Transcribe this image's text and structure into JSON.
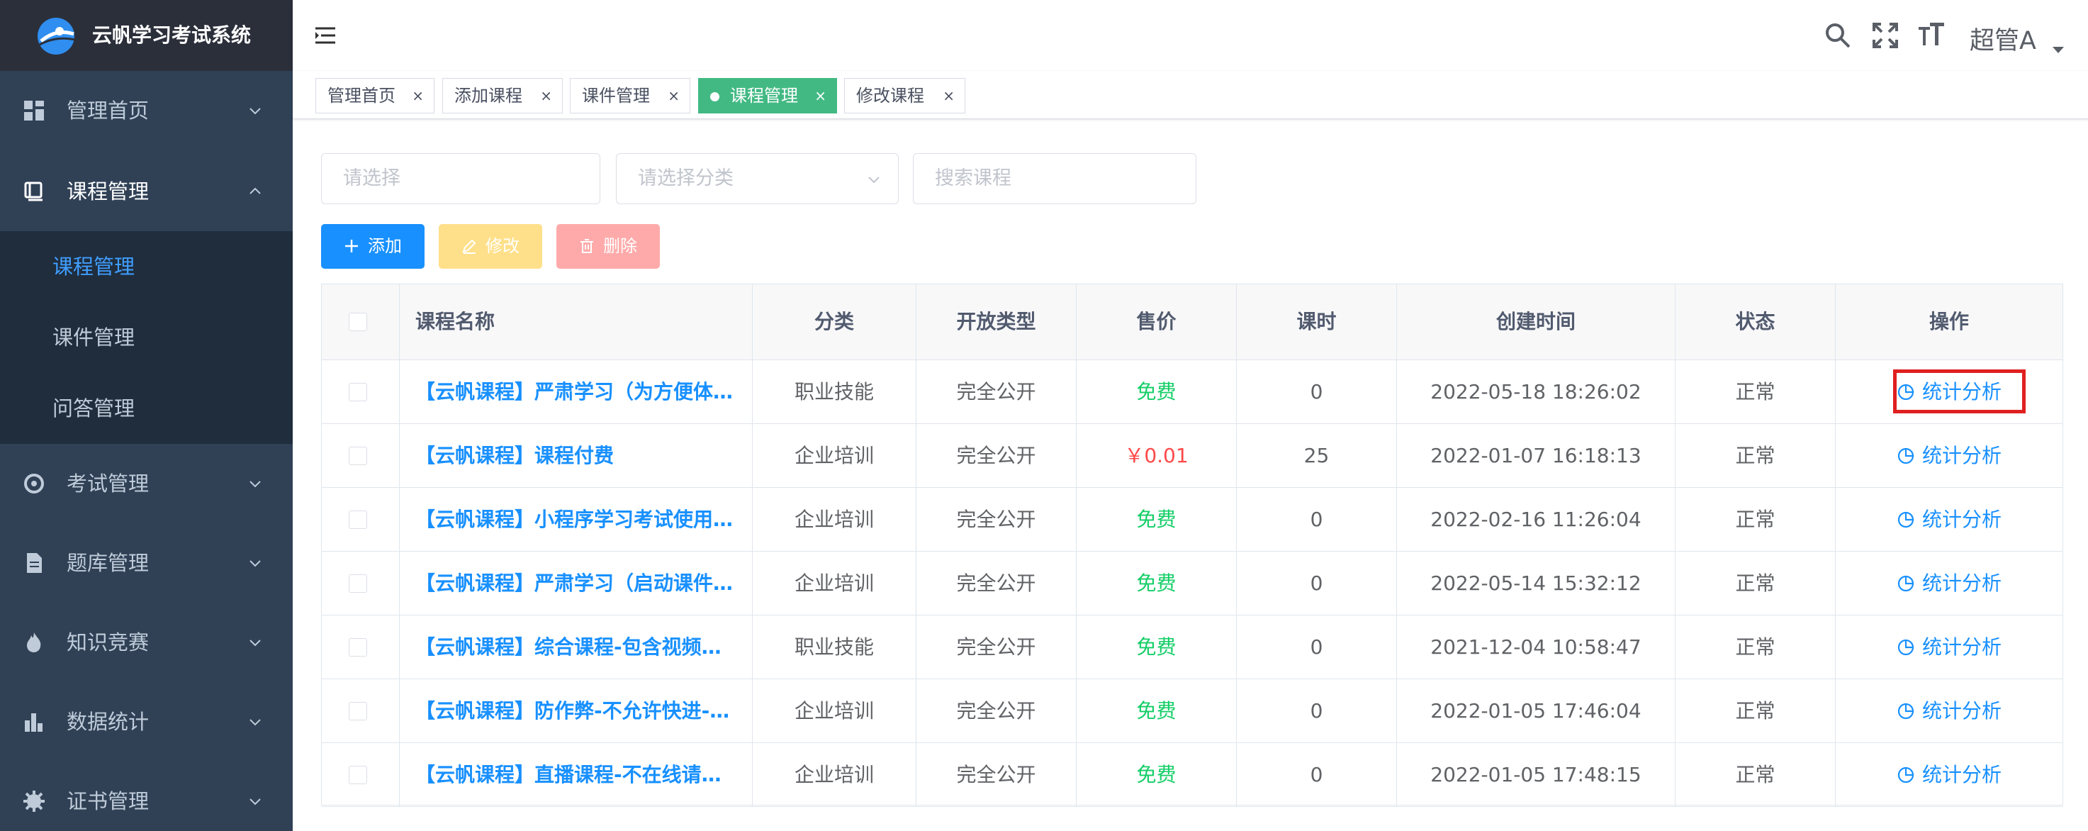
{
  "app": {
    "title": "云帆学习考试系统"
  },
  "sidebar": {
    "menus": [
      {
        "label": "管理首页",
        "icon": "dashboard-icon"
      },
      {
        "label": "课程管理",
        "icon": "book-icon",
        "open": true,
        "children": [
          {
            "label": "课程管理",
            "active": true
          },
          {
            "label": "课件管理"
          },
          {
            "label": "问答管理"
          }
        ]
      },
      {
        "label": "考试管理",
        "icon": "exam-icon"
      },
      {
        "label": "题库管理",
        "icon": "document-icon"
      },
      {
        "label": "知识竞赛",
        "icon": "fire-icon"
      },
      {
        "label": "数据统计",
        "icon": "bar-chart-icon"
      },
      {
        "label": "证书管理",
        "icon": "certificate-icon"
      }
    ]
  },
  "header": {
    "user": "超管A",
    "icons": [
      "search-icon",
      "fullscreen-icon",
      "font-size-icon"
    ]
  },
  "tags": [
    {
      "label": "管理首页"
    },
    {
      "label": "添加课程"
    },
    {
      "label": "课件管理"
    },
    {
      "label": "课程管理",
      "active": true
    },
    {
      "label": "修改课程"
    }
  ],
  "filters": {
    "select_placeholder": "请选择",
    "category_placeholder": "请选择分类",
    "search_placeholder": "搜索课程"
  },
  "toolbar": {
    "add": "添加",
    "edit": "修改",
    "delete": "删除"
  },
  "table": {
    "headers": [
      "课程名称",
      "分类",
      "开放类型",
      "售价",
      "课时",
      "创建时间",
      "状态",
      "操作"
    ],
    "rows": [
      {
        "name": "【云帆课程】严肃学习（为方便体验，视频可快进）",
        "category": "职业技能",
        "open_type": "完全公开",
        "price": "免费",
        "hours": "0",
        "created": "2022-05-18 18:26:02",
        "status": "正常",
        "action": "统计分析"
      },
      {
        "name": "【云帆课程】课程付费",
        "category": "企业培训",
        "open_type": "完全公开",
        "price": "￥0.01",
        "hours": "25",
        "created": "2022-01-07 16:18:13",
        "status": "正常",
        "action": "统计分析"
      },
      {
        "name": "【云帆课程】小程序学习考试使用说明",
        "category": "企业培训",
        "open_type": "完全公开",
        "price": "免费",
        "hours": "0",
        "created": "2022-02-16 11:26:04",
        "status": "正常",
        "action": "统计分析"
      },
      {
        "name": "【云帆课程】严肃学习（启动课件后方可学习）",
        "category": "企业培训",
        "open_type": "完全公开",
        "price": "免费",
        "hours": "0",
        "created": "2022-05-14 15:32:12",
        "status": "正常",
        "action": "统计分析"
      },
      {
        "name": "【云帆课程】综合课程-包含视频、文档、音频",
        "category": "职业技能",
        "open_type": "完全公开",
        "price": "免费",
        "hours": "0",
        "created": "2021-12-04 10:58:47",
        "status": "正常",
        "action": "统计分析"
      },
      {
        "name": "【云帆课程】防作弊-不允许快进-离开暂停",
        "category": "企业培训",
        "open_type": "完全公开",
        "price": "免费",
        "hours": "0",
        "created": "2022-01-05 17:46:04",
        "status": "正常",
        "action": "统计分析"
      },
      {
        "name": "【云帆课程】直播课程-不在线请勿学习",
        "category": "企业培训",
        "open_type": "完全公开",
        "price": "免费",
        "hours": "0",
        "created": "2022-01-05 17:48:15",
        "status": "正常",
        "action": "统计分析"
      }
    ]
  },
  "colors": {
    "sidebar_bg": "#304156",
    "primary": "#1890ff",
    "tag_active": "#42b983",
    "free": "#13ce66",
    "paid": "#ff4949",
    "highlight": "#e02020"
  }
}
